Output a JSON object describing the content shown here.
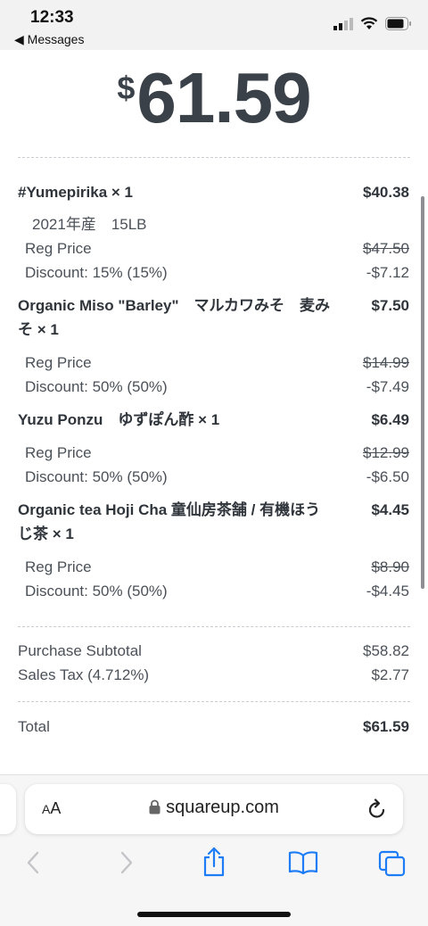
{
  "status_bar": {
    "time": "12:33",
    "back_label": "◀ Messages"
  },
  "receipt": {
    "currency_symbol": "$",
    "amount": "61.59",
    "items": [
      {
        "name": "#Yumepirika × 1",
        "price": "$40.38",
        "note": "2021年産　15LB",
        "reg_label": "Reg Price",
        "reg_price": "$47.50",
        "discount_label": "Discount: 15% (15%)",
        "discount": "-$7.12"
      },
      {
        "name_line1": "Organic Miso \"Barley\"　マルカワみそ　麦み",
        "name_line2": "そ × 1",
        "price": "$7.50",
        "reg_label": "Reg Price",
        "reg_price": "$14.99",
        "discount_label": "Discount: 50% (50%)",
        "discount": "-$7.49"
      },
      {
        "name": "Yuzu Ponzu　ゆずぽん酢 × 1",
        "price": "$6.49",
        "reg_label": "Reg Price",
        "reg_price": "$12.99",
        "discount_label": "Discount: 50% (50%)",
        "discount": "-$6.50"
      },
      {
        "name_line1": "Organic tea Hoji Cha 童仙房茶舗 / 有機ほう",
        "name_line2": "じ茶 × 1",
        "price": "$4.45",
        "reg_label": "Reg Price",
        "reg_price": "$8.90",
        "discount_label": "Discount: 50% (50%)",
        "discount": "-$4.45"
      }
    ],
    "subtotal_label": "Purchase Subtotal",
    "subtotal": "$58.82",
    "tax_label": "Sales Tax (4.712%)",
    "tax": "$2.77",
    "total_label": "Total",
    "total": "$61.59"
  },
  "safari": {
    "aa_label_small": "A",
    "aa_label_big": "A",
    "url": "squareup.com"
  },
  "icons": [
    "signal-icon",
    "wifi-icon",
    "battery-icon",
    "lock-icon",
    "reload-icon",
    "back-icon",
    "forward-icon",
    "share-icon",
    "bookmarks-icon",
    "tabs-icon"
  ]
}
